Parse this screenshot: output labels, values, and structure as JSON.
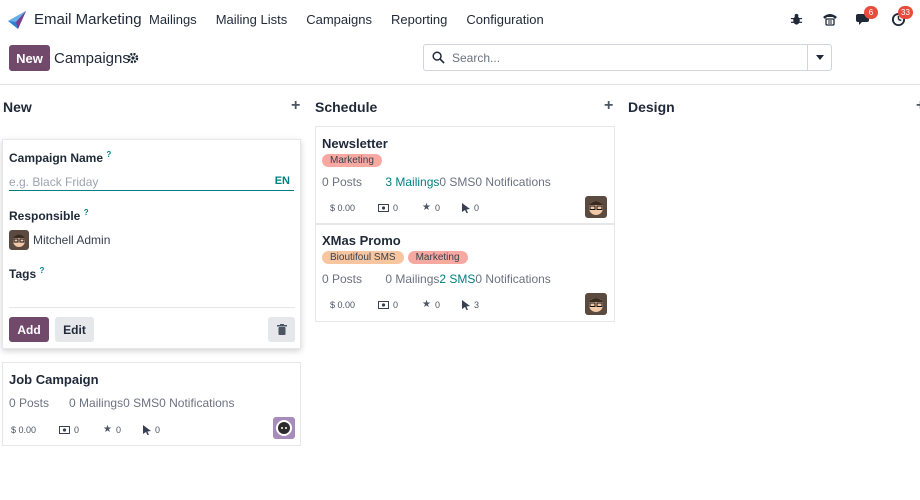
{
  "navbar": {
    "app_name": "Email Marketing",
    "menu": [
      "Mailings",
      "Mailing Lists",
      "Campaigns",
      "Reporting",
      "Configuration"
    ],
    "messages_count": "6",
    "activities_count": "33"
  },
  "control": {
    "new_label": "New",
    "title": "Campaigns",
    "search_placeholder": "Search..."
  },
  "columns": {
    "new": "New",
    "schedule": "Schedule",
    "design": "Design"
  },
  "quick_create": {
    "campaign_name_label": "Campaign Name",
    "campaign_name_placeholder": "e.g. Black Friday",
    "lang": "EN",
    "responsible_label": "Responsible",
    "responsible_name": "Mitchell Admin",
    "tags_label": "Tags",
    "help": "?",
    "add_label": "Add",
    "edit_label": "Edit"
  },
  "cards": [
    {
      "title": "Job Campaign",
      "tags": [],
      "posts": "0 Posts",
      "mailings": "0 Mailings",
      "sms": "0 SMS",
      "notifications": "0 Notifications",
      "revenue": "$ 0.00",
      "clicks_money": "0",
      "stars": "0",
      "cursor": "0"
    },
    {
      "title": "Newsletter",
      "tags": [
        "Marketing"
      ],
      "posts": "0 Posts",
      "mailings": "3 Mailings",
      "sms": "0 SMS",
      "notifications": "0 Notifications",
      "revenue": "$ 0.00",
      "clicks_money": "0",
      "stars": "0",
      "cursor": "0"
    },
    {
      "title": "XMas Promo",
      "tags": [
        "Bioutifoul SMS",
        "Marketing"
      ],
      "posts": "0 Posts",
      "mailings": "0 Mailings",
      "sms": "2 SMS",
      "notifications": "0 Notifications",
      "revenue": "$ 0.00",
      "clicks_money": "0",
      "stars": "0",
      "cursor": "3"
    }
  ],
  "colors": {
    "primary": "#71496b",
    "link": "#017e84",
    "tag_red": "#f7a8a0",
    "tag_orange": "#f7c59f",
    "badge": "#e74c3c"
  }
}
